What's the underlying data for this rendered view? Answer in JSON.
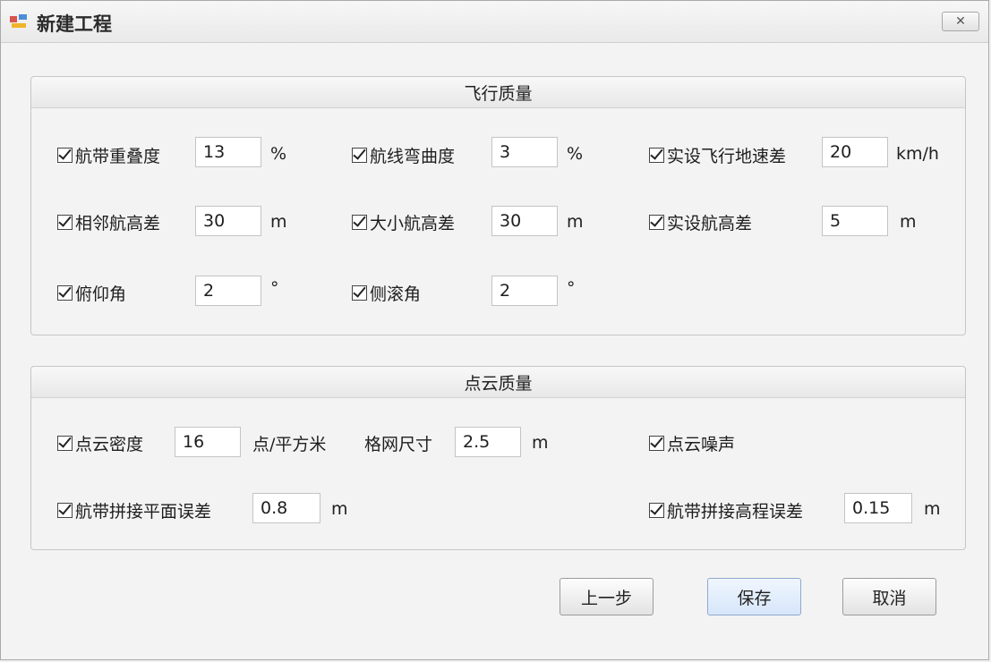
{
  "window": {
    "title": "新建工程",
    "close_label": "✕"
  },
  "flight_quality": {
    "title": "飞行质量",
    "items": [
      {
        "label": "航带重叠度",
        "value": "13",
        "unit": "%",
        "checked": true
      },
      {
        "label": "航线弯曲度",
        "value": "3",
        "unit": "%",
        "checked": true
      },
      {
        "label": "实设飞行地速差",
        "value": "20",
        "unit": "km/h",
        "checked": true
      },
      {
        "label": "相邻航高差",
        "value": "30",
        "unit": "m",
        "checked": true
      },
      {
        "label": "大小航高差",
        "value": "30",
        "unit": "m",
        "checked": true
      },
      {
        "label": "实设航高差",
        "value": "5",
        "unit": "m",
        "checked": true
      },
      {
        "label": "俯仰角",
        "value": "2",
        "unit": "°",
        "checked": true
      },
      {
        "label": "侧滚角",
        "value": "2",
        "unit": "°",
        "checked": true
      }
    ]
  },
  "point_cloud_quality": {
    "title": "点云质量",
    "density": {
      "label": "点云密度",
      "value": "16",
      "unit": "点/平方米",
      "checked": true
    },
    "grid": {
      "label": "格网尺寸",
      "value": "2.5",
      "unit": "m"
    },
    "noise": {
      "label": "点云噪声",
      "checked": true
    },
    "plane_error": {
      "label": "航带拼接平面误差",
      "value": "0.8",
      "unit": "m",
      "checked": true
    },
    "height_error": {
      "label": "航带拼接高程误差",
      "value": "0.15",
      "unit": "m",
      "checked": true
    }
  },
  "buttons": {
    "prev": "上一步",
    "save": "保存",
    "cancel": "取消"
  }
}
